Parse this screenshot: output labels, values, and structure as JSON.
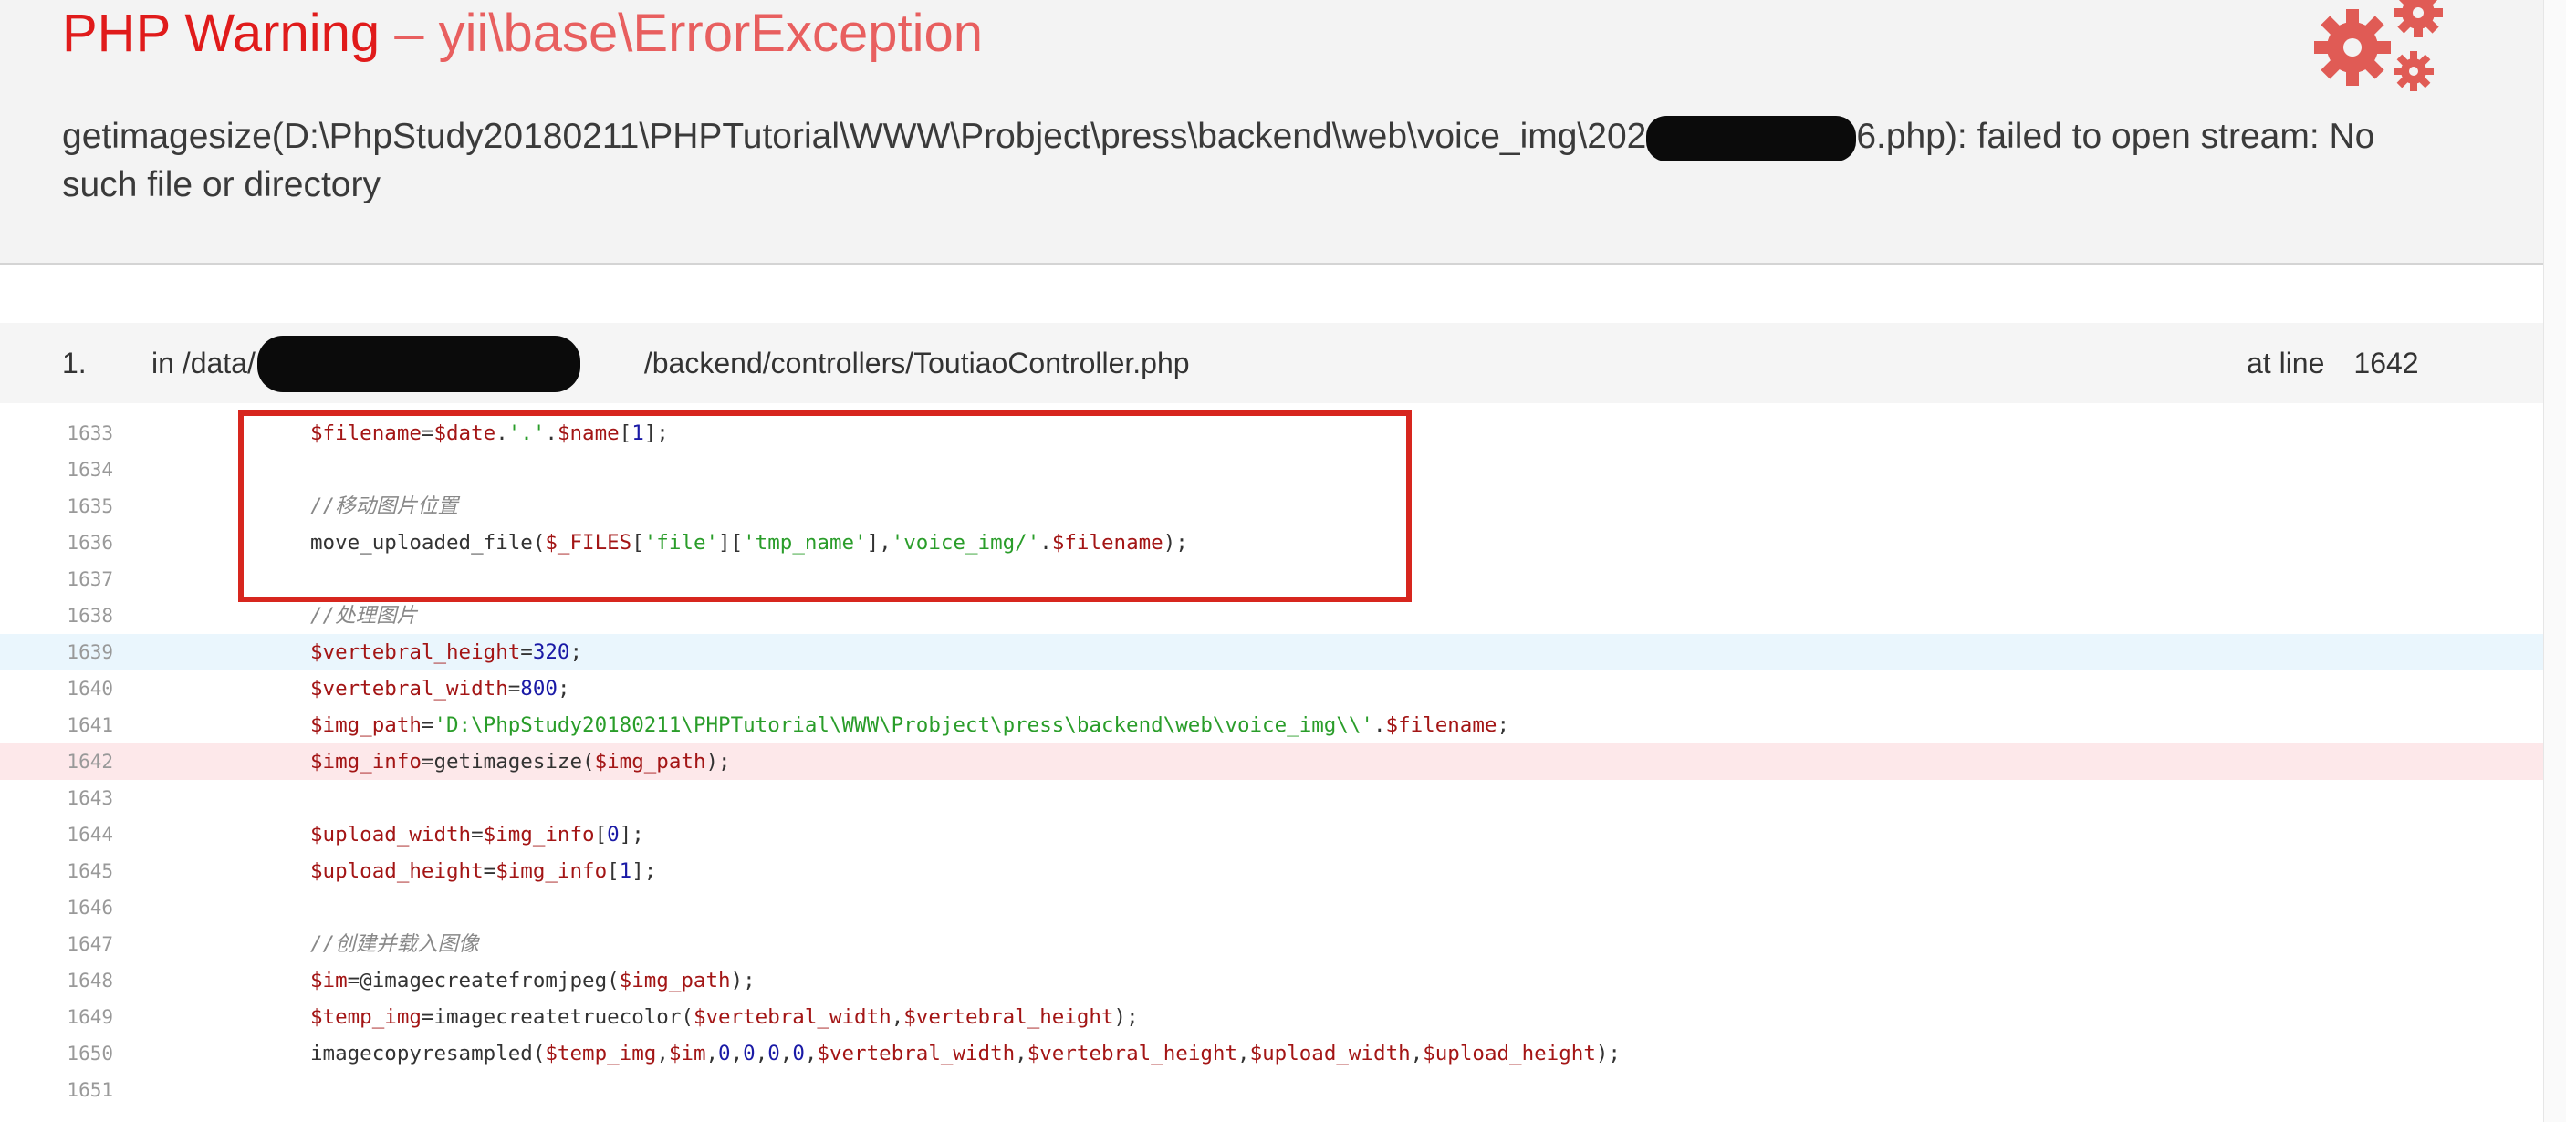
{
  "header": {
    "warning": "PHP Warning",
    "exception": " – yii\\base\\ErrorException",
    "message_before": "getimagesize(D:\\PhpStudy20180211\\PHPTutorial\\WWW\\Probject\\press\\backend\\web\\voice_img\\202",
    "message_after": "6.php): failed to open stream: No such file or directory"
  },
  "frame": {
    "number": "1.",
    "file_prefix": "in /data/",
    "file_suffix": "/backend/controllers/ToutiaoController.php",
    "at_line_label": "at line",
    "line": "1642"
  },
  "code": {
    "lines": [
      {
        "num": "1633"
      },
      {
        "num": "1634"
      },
      {
        "num": "1635"
      },
      {
        "num": "1636"
      },
      {
        "num": "1637"
      },
      {
        "num": "1638"
      },
      {
        "num": "1639"
      },
      {
        "num": "1640"
      },
      {
        "num": "1641"
      },
      {
        "num": "1642"
      },
      {
        "num": "1643"
      },
      {
        "num": "1644"
      },
      {
        "num": "1645"
      },
      {
        "num": "1646"
      },
      {
        "num": "1647"
      },
      {
        "num": "1648"
      },
      {
        "num": "1649"
      },
      {
        "num": "1650"
      },
      {
        "num": "1651"
      }
    ],
    "t": {
      "l1633": [
        "$filename",
        "=",
        "$date",
        ".",
        "'.'",
        ".",
        "$name",
        "[",
        "1",
        "];"
      ],
      "l1635": [
        "//移动图片位置"
      ],
      "l1636": [
        "move_uploaded_file(",
        "$_FILES",
        "[",
        "'file'",
        "][",
        "'tmp_name'",
        "],",
        "'voice_img/'",
        ".",
        "$filename",
        ");"
      ],
      "l1638": [
        "//处理图片"
      ],
      "l1639": [
        "$vertebral_height",
        "=",
        "320",
        ";"
      ],
      "l1640": [
        "$vertebral_width",
        "=",
        "800",
        ";"
      ],
      "l1641": [
        "$img_path",
        "=",
        "'D:\\PhpStudy20180211\\PHPTutorial\\WWW\\Probject\\press\\backend\\web\\voice_img\\\\'",
        ".",
        "$filename",
        ";"
      ],
      "l1642": [
        "$img_info",
        "=getimagesize(",
        "$img_path",
        ");"
      ],
      "l1644": [
        "$upload_width",
        "=",
        "$img_info",
        "[",
        "0",
        "];"
      ],
      "l1645": [
        "$upload_height",
        "=",
        "$img_info",
        "[",
        "1",
        "];"
      ],
      "l1647": [
        "//创建并载入图像"
      ],
      "l1648": [
        "$im",
        "=@imagecreatefromjpeg(",
        "$img_path",
        ");"
      ],
      "l1649": [
        "$temp_img",
        "=imagecreatetruecolor(",
        "$vertebral_width",
        ",",
        "$vertebral_height",
        ");"
      ],
      "l1650": [
        "imagecopyresampled(",
        "$temp_img",
        ",",
        "$im",
        ",",
        "0",
        ",",
        "0",
        ",",
        "0",
        ",",
        "0",
        ",",
        "$vertebral_width",
        ",",
        "$vertebral_height",
        ",",
        "$upload_width",
        ",",
        "$upload_height",
        ");"
      ]
    }
  },
  "colors": {
    "title_red": "#e01b1b",
    "exception_red": "#e85f5f",
    "highlight_error_line": "#fde8ea",
    "highlight_line": "#eaf6fd",
    "annotation_box": "#d7261e"
  },
  "icons": {
    "logo": "gears-icon"
  }
}
